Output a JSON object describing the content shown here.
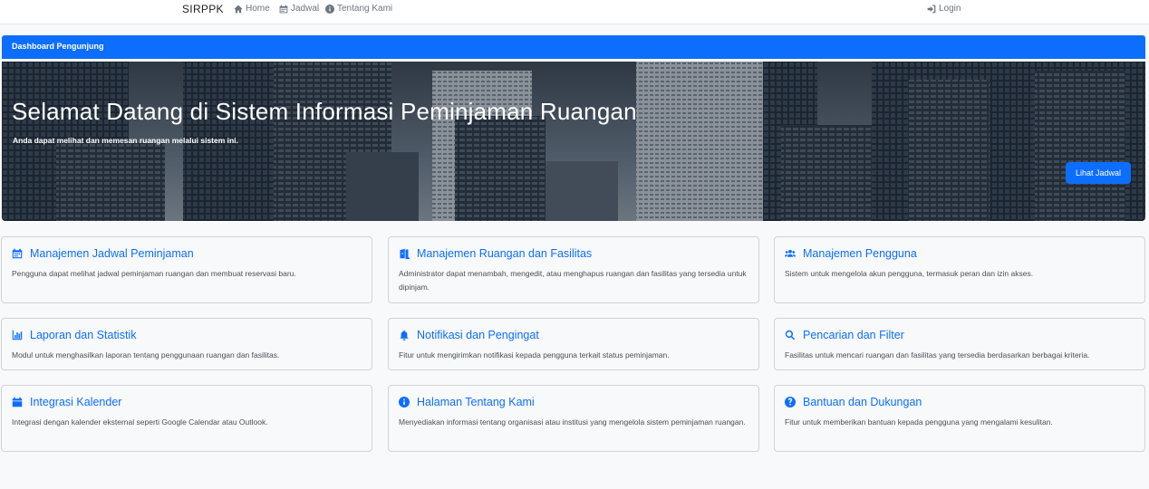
{
  "navbar": {
    "brand": "SIRPPK",
    "home": "Home",
    "jadwal": "Jadwal",
    "tentang": "Tentang Kami",
    "login": "Login"
  },
  "header": {
    "title": "Dashboard Pengunjung"
  },
  "hero": {
    "title": "Selamat Datang di Sistem Informasi Peminjaman Ruangan",
    "subtitle": "Anda dapat melihat dan memesan ruangan melalui sistem ini.",
    "button": "Lihat Jadwal"
  },
  "cards": [
    {
      "icon": "calendar-icon",
      "title": "Manajemen Jadwal Peminjaman",
      "text": "Pengguna dapat melihat jadwal peminjaman ruangan dan membuat reservasi baru."
    },
    {
      "icon": "door-icon",
      "title": "Manajemen Ruangan dan Fasilitas",
      "text": "Administrator dapat menambah, mengedit, atau menghapus ruangan dan fasilitas yang tersedia untuk dipinjam."
    },
    {
      "icon": "users-icon",
      "title": "Manajemen Pengguna",
      "text": "Sistem untuk mengelola akun pengguna, termasuk peran dan izin akses."
    },
    {
      "icon": "chart-icon",
      "title": "Laporan dan Statistik",
      "text": "Modul untuk menghasilkan laporan tentang penggunaan ruangan dan fasilitas."
    },
    {
      "icon": "bell-icon",
      "title": "Notifikasi dan Pengingat",
      "text": "Fitur untuk mengirimkan notifikasi kepada pengguna terkait status peminjaman."
    },
    {
      "icon": "search-icon",
      "title": "Pencarian dan Filter",
      "text": "Fasilitas untuk mencari ruangan dan fasilitas yang tersedia berdasarkan berbagai kriteria."
    },
    {
      "icon": "calendar-solid-icon",
      "title": "Integrasi Kalender",
      "text": "Integrasi dengan kalender eksternal seperti Google Calendar atau Outlook."
    },
    {
      "icon": "info-circle-icon",
      "title": "Halaman Tentang Kami",
      "text": "Menyediakan informasi tentang organisasi atau institusi yang mengelola sistem peminjaman ruangan."
    },
    {
      "icon": "question-circle-icon",
      "title": "Bantuan dan Dukungan",
      "text": "Fitur untuk memberikan bantuan kepada pengguna yang mengalami kesulitan."
    }
  ],
  "colors": {
    "primary": "#0d6efd",
    "background": "#f8f9fa",
    "border": "#ced4da"
  }
}
